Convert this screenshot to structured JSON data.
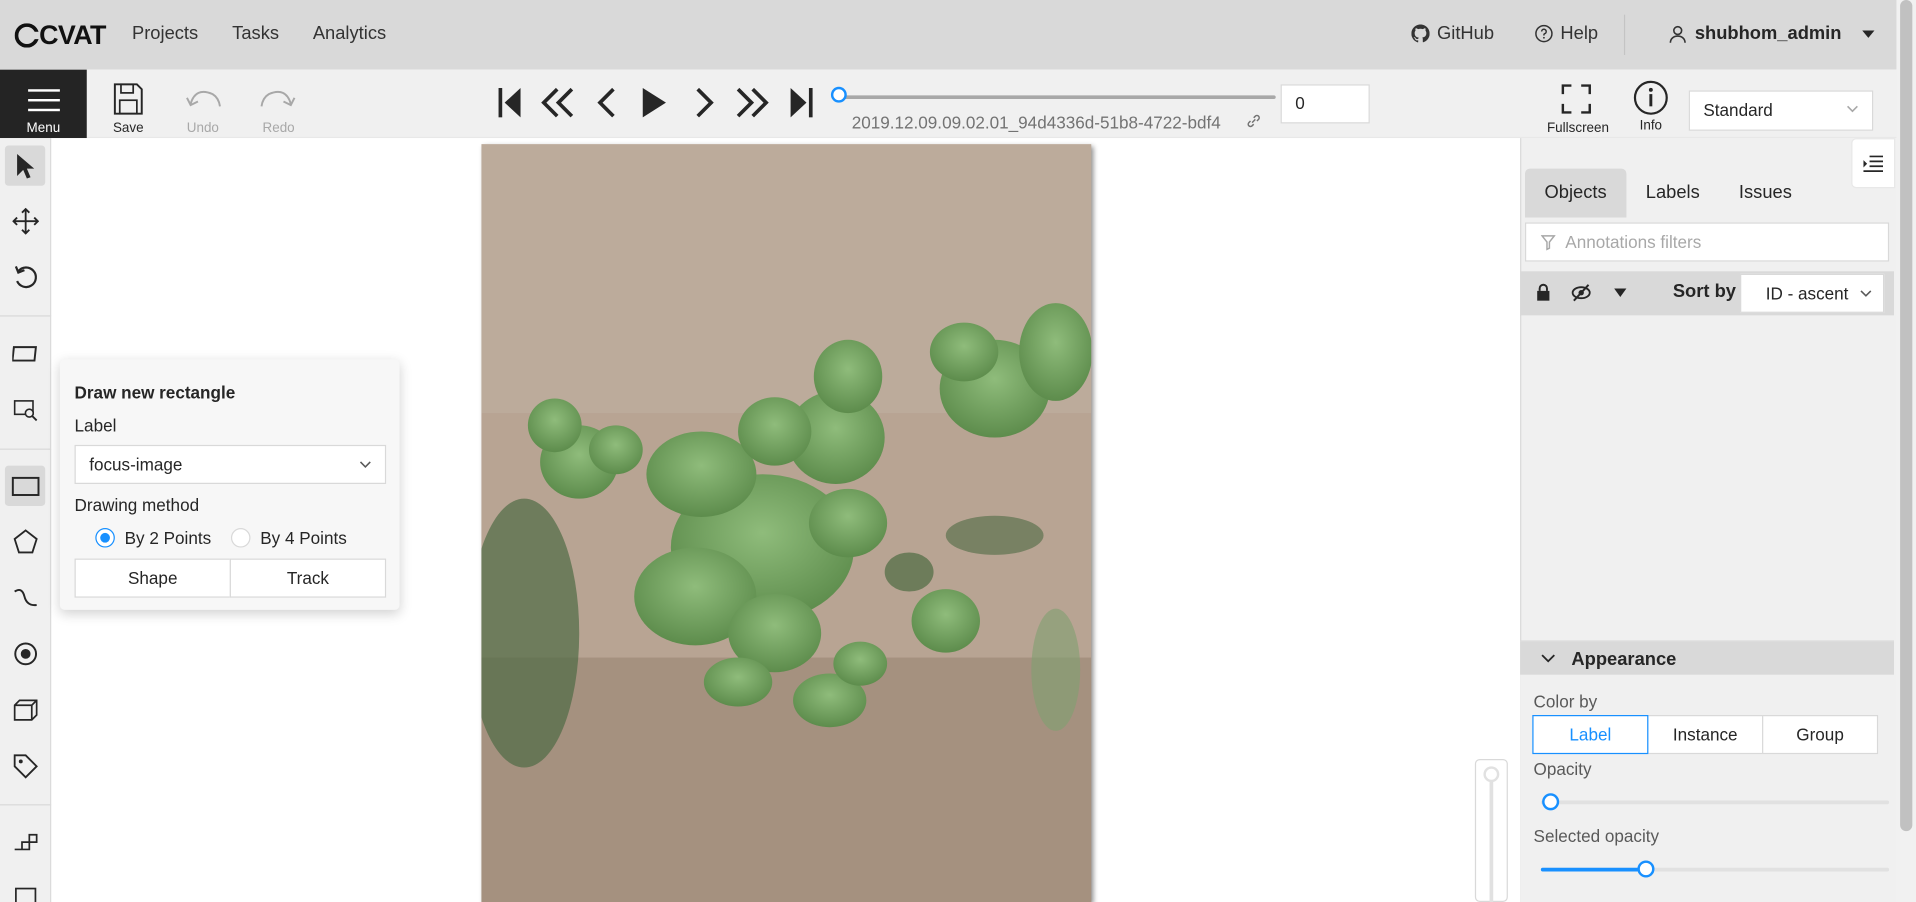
{
  "header": {
    "logo": "CVAT",
    "nav": [
      "Projects",
      "Tasks",
      "Analytics"
    ],
    "github": "GitHub",
    "help": "Help",
    "user": "shubhom_admin"
  },
  "toolbar": {
    "menu_label": "Menu",
    "save_label": "Save",
    "undo_label": "Undo",
    "redo_label": "Redo",
    "filename": "2019.12.09.09.02.01_94d4336d-51b8-4722-bdf4",
    "frame_number": "0",
    "fullscreen_label": "Fullscreen",
    "info_label": "Info",
    "workspace": "Standard"
  },
  "popover": {
    "title": "Draw new rectangle",
    "label_title": "Label",
    "label_value": "focus-image",
    "method_title": "Drawing method",
    "method_2": "By 2 Points",
    "method_4": "By 4 Points",
    "selected_method": "By 2 Points",
    "shape_button": "Shape",
    "track_button": "Track"
  },
  "sidebar": {
    "tabs": [
      "Objects",
      "Labels",
      "Issues"
    ],
    "active_tab": "Objects",
    "filter_placeholder": "Annotations filters",
    "sort_by_label": "Sort by",
    "sort_value": "ID - ascent",
    "appearance": {
      "title": "Appearance",
      "color_by_label": "Color by",
      "color_by_options": [
        "Label",
        "Instance",
        "Group"
      ],
      "color_by_selected": "Label",
      "opacity_label": "Opacity",
      "opacity_value": 0,
      "selected_opacity_label": "Selected opacity",
      "selected_opacity_value": 0.3
    }
  },
  "colors": {
    "accent": "#1890ff",
    "header_bg": "#d9d9d9",
    "menu_bg": "#242424"
  }
}
